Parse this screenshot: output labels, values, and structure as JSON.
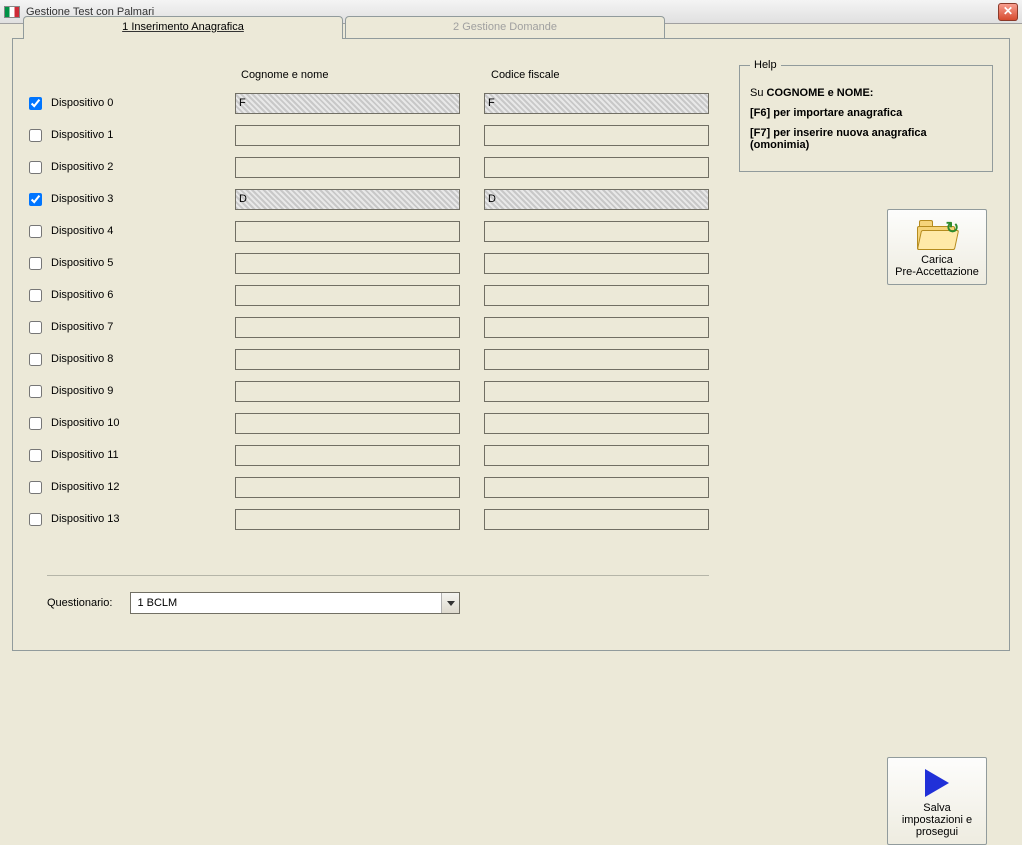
{
  "window": {
    "title": "Gestione Test con Palmari"
  },
  "tabs": [
    {
      "label": "1 Inserimento Anagrafica",
      "active": true
    },
    {
      "label": "2 Gestione Domande",
      "active": false
    }
  ],
  "columns": {
    "name": "Cognome e nome",
    "cf": "Codice fiscale"
  },
  "devices": [
    {
      "label": "Dispositivo 0",
      "checked": true,
      "name": "F",
      "cf": "F",
      "redacted": true
    },
    {
      "label": "Dispositivo 1",
      "checked": false,
      "name": "",
      "cf": "",
      "redacted": false
    },
    {
      "label": "Dispositivo 2",
      "checked": false,
      "name": "",
      "cf": "",
      "redacted": false
    },
    {
      "label": "Dispositivo 3",
      "checked": true,
      "name": "D",
      "cf": "D",
      "redacted": true
    },
    {
      "label": "Dispositivo 4",
      "checked": false,
      "name": "",
      "cf": "",
      "redacted": false
    },
    {
      "label": "Dispositivo 5",
      "checked": false,
      "name": "",
      "cf": "",
      "redacted": false
    },
    {
      "label": "Dispositivo 6",
      "checked": false,
      "name": "",
      "cf": "",
      "redacted": false
    },
    {
      "label": "Dispositivo 7",
      "checked": false,
      "name": "",
      "cf": "",
      "redacted": false
    },
    {
      "label": "Dispositivo 8",
      "checked": false,
      "name": "",
      "cf": "",
      "redacted": false
    },
    {
      "label": "Dispositivo 9",
      "checked": false,
      "name": "",
      "cf": "",
      "redacted": false
    },
    {
      "label": "Dispositivo 10",
      "checked": false,
      "name": "",
      "cf": "",
      "redacted": false
    },
    {
      "label": "Dispositivo 11",
      "checked": false,
      "name": "",
      "cf": "",
      "redacted": false
    },
    {
      "label": "Dispositivo 12",
      "checked": false,
      "name": "",
      "cf": "",
      "redacted": false
    },
    {
      "label": "Dispositivo 13",
      "checked": false,
      "name": "",
      "cf": "",
      "redacted": false
    }
  ],
  "help": {
    "legend": "Help",
    "line1_prefix": "Su ",
    "line1_bold": "COGNOME e NOME:",
    "line2": "[F6] per importare anagrafica",
    "line3": "[F7] per inserire nuova anagrafica (omonimia)"
  },
  "buttons": {
    "load": "Carica\nPre-Accettazione",
    "save": "Salva impostazioni e prosegui"
  },
  "questionario": {
    "label": "Questionario:",
    "selected": "1 BCLM"
  }
}
